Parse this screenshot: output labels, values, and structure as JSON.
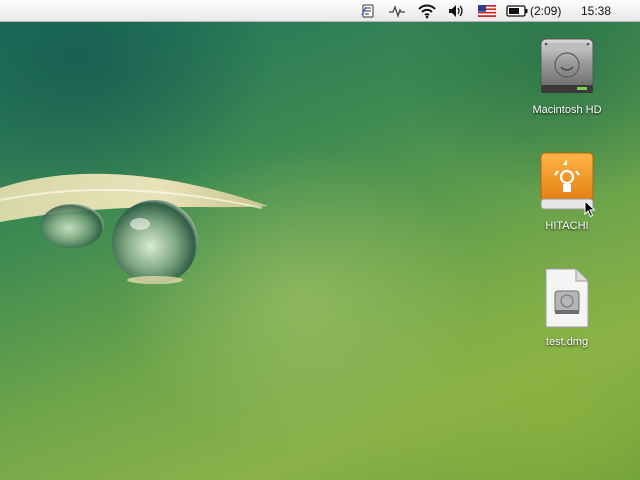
{
  "menubar": {
    "extras": [
      {
        "icon": "script-menu-icon"
      },
      {
        "icon": "activity-pulse-icon"
      },
      {
        "icon": "wifi-icon"
      },
      {
        "icon": "volume-icon"
      },
      {
        "icon": "us-flag-input-icon"
      },
      {
        "icon": "battery-icon"
      }
    ],
    "battery_time": "(2:09)",
    "clock": "15:38"
  },
  "desktop": {
    "icons": [
      {
        "label": "Macintosh HD",
        "icon": "hard-drive-icon"
      },
      {
        "label": "HITACHI",
        "icon": "firewire-drive-icon",
        "color": "#f0961e"
      },
      {
        "label": "test.dmg",
        "icon": "disk-image-icon"
      }
    ]
  },
  "colors": {
    "menubar_bg": "#f2f2f2",
    "wallpaper_primary": "#3d8a52",
    "firewire_orange": "#f0961e"
  }
}
